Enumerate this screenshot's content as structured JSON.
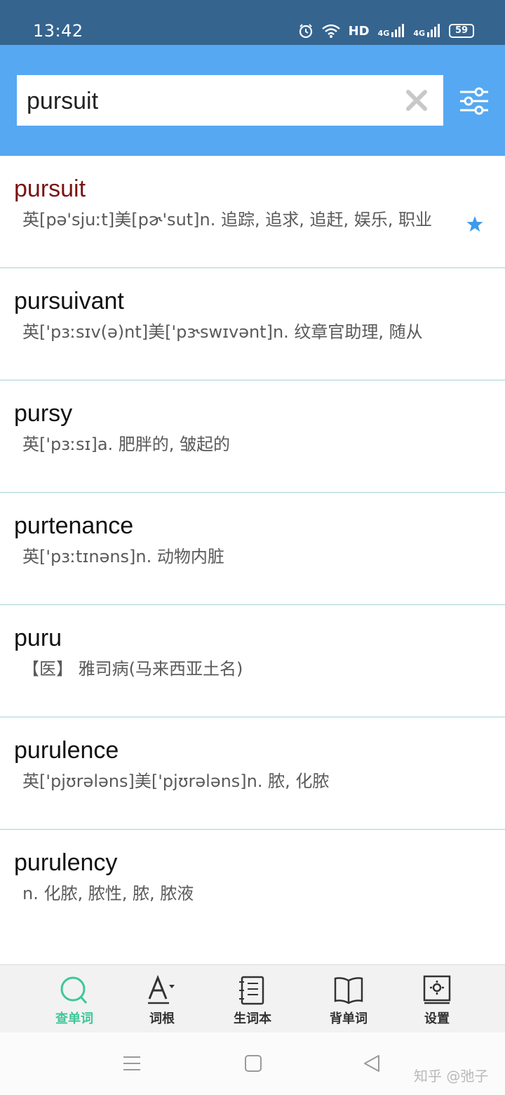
{
  "status_bar": {
    "time": "13:42",
    "network_label": "HD",
    "signal_1": "4G",
    "signal_2": "4G",
    "battery": "59",
    "icons": [
      "alarm-icon",
      "wifi-icon",
      "signal-icon",
      "signal-icon",
      "battery-icon"
    ]
  },
  "search": {
    "value": "pursuit",
    "placeholder": "",
    "clear_icon": "close-icon",
    "filter_icon": "filter-icon"
  },
  "results": [
    {
      "word": "pursuit",
      "definition": "英[pə'sjuːt]美[pɚ'sut]n. 追踪, 追求, 追赶, 娱乐, 职业",
      "starred": true
    },
    {
      "word": "pursuivant",
      "definition": "英['pɜːsɪv(ə)nt]美['pɝswɪvənt]n. 纹章官助理, 随从",
      "starred": false
    },
    {
      "word": "pursy",
      "definition": "英['pɜːsɪ]a. 肥胖的, 皱起的",
      "starred": false
    },
    {
      "word": "purtenance",
      "definition": "英['pɜːtɪnəns]n. 动物内脏",
      "starred": false
    },
    {
      "word": "puru",
      "definition": "【医】 雅司病(马来西亚土名)",
      "starred": false
    },
    {
      "word": "purulence",
      "definition": "英['pjʊrələns]美['pjʊrələns]n. 脓, 化脓",
      "starred": false
    },
    {
      "word": "purulency",
      "definition": "n. 化脓, 脓性, 脓, 脓液",
      "starred": false
    }
  ],
  "bottom_nav": [
    {
      "label": "查单词",
      "icon": "search-icon",
      "active": true
    },
    {
      "label": "词根",
      "icon": "font-icon",
      "active": false
    },
    {
      "label": "生词本",
      "icon": "notebook-icon",
      "active": false
    },
    {
      "label": "背单词",
      "icon": "book-icon",
      "active": false
    },
    {
      "label": "设置",
      "icon": "settings-icon",
      "active": false
    }
  ],
  "colors": {
    "status_bar": "#35648f",
    "header": "#56a8f2",
    "active_word": "#7a1414",
    "nav_active": "#3ec79a",
    "star": "#3d9be9",
    "divider": "#a7d3d0"
  },
  "watermark": "知乎 @弛子"
}
